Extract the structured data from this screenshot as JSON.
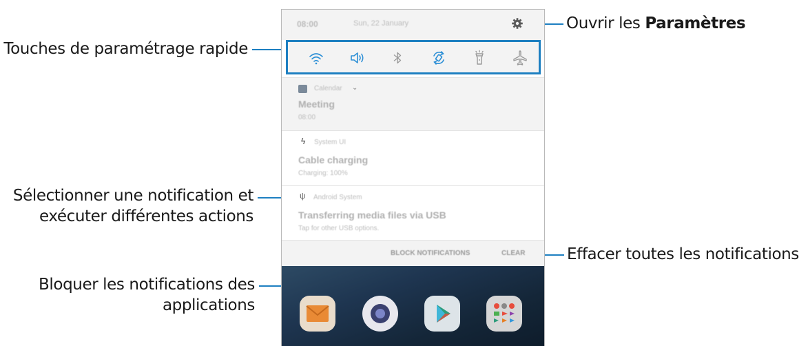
{
  "callouts": {
    "quick_settings": "Touches de paramétrage rapide",
    "open_settings_prefix": "Ouvrir les ",
    "open_settings_bold": "Paramètres",
    "select_notification_line1": "Sélectionner une notification et",
    "select_notification_line2": "exécuter différentes actions",
    "clear_all": "Effacer toutes les notifications",
    "block_line1": "Bloquer les notifications des",
    "block_line2": "applications"
  },
  "phone": {
    "status": {
      "time": "08:00",
      "date": "Sun, 22 January"
    },
    "quick_settings_icons": [
      "wifi-icon",
      "sound-icon",
      "bluetooth-icon",
      "auto-rotate-icon",
      "flashlight-icon",
      "airplane-mode-icon"
    ],
    "notifications": [
      {
        "app": "Calendar",
        "title": "Meeting",
        "text": "08:00"
      },
      {
        "app": "System UI",
        "title": "Cable charging",
        "text": "Charging: 100%"
      },
      {
        "app": "Android System",
        "title": "Transferring media files via USB",
        "text": "Tap for other USB options."
      }
    ],
    "actions": {
      "block": "BLOCK NOTIFICATIONS",
      "clear": "CLEAR"
    },
    "home_apps": [
      "Email",
      "Camera",
      "Play Store",
      "Google"
    ]
  },
  "colors": {
    "accent": "#1d7fc1",
    "panel": "#f3f3f3"
  }
}
